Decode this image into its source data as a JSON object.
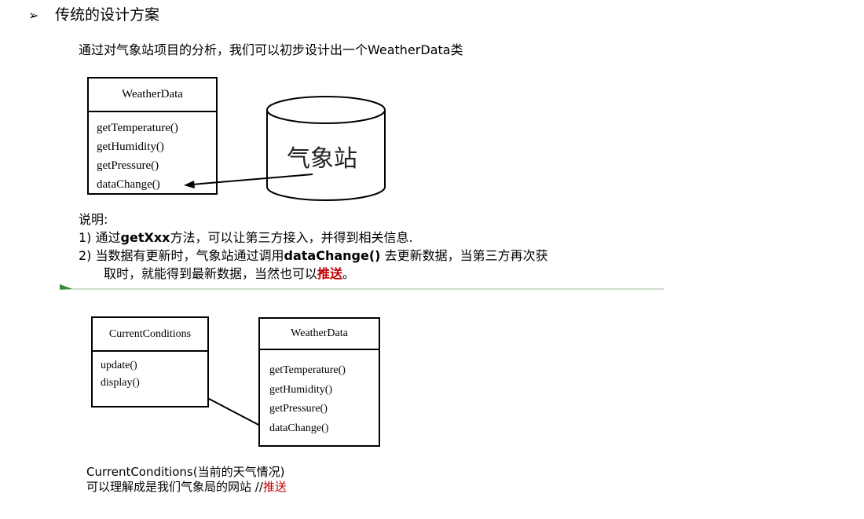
{
  "heading": {
    "bullet": "➢",
    "text": "传统的设计方案"
  },
  "intro": "通过对气象站项目的分析，我们可以初步设计出一个WeatherData类",
  "diagram1": {
    "class_name": "WeatherData",
    "methods": [
      "getTemperature()",
      "getHumidity()",
      "getPressure()",
      "dataChange()"
    ],
    "cylinder_label": "气象站"
  },
  "notes": {
    "title": "说明:",
    "item1_num": "1)",
    "item1_pre": "通过",
    "item1_bold": "getXxx",
    "item1_post": "方法，可以让第三方接入，并得到相关信息.",
    "item2_num": "2)",
    "item2_pre": "当数据有更新时，气象站通过调用",
    "item2_bold": "dataChange()",
    "item2_post": " 去更新数据，当第三方再次获",
    "item2_line2_pre": "取时，就能得到最新数据，当然也可以",
    "item2_line2_red": "推送",
    "item2_line2_post": "。"
  },
  "diagram2": {
    "left_class": {
      "name": "CurrentConditions",
      "methods": [
        "update()",
        "display()"
      ]
    },
    "right_class": {
      "name": "WeatherData",
      "methods": [
        "getTemperature()",
        "getHumidity()",
        "getPressure()",
        "dataChange()"
      ]
    }
  },
  "caption": {
    "line1": "CurrentConditions(当前的天气情况)",
    "line2_pre": "可以理解成是我们气象局的网站 //",
    "line2_red": "推送"
  },
  "colors": {
    "accent_red": "#c00000",
    "divider_green": "#3a8a3a"
  }
}
